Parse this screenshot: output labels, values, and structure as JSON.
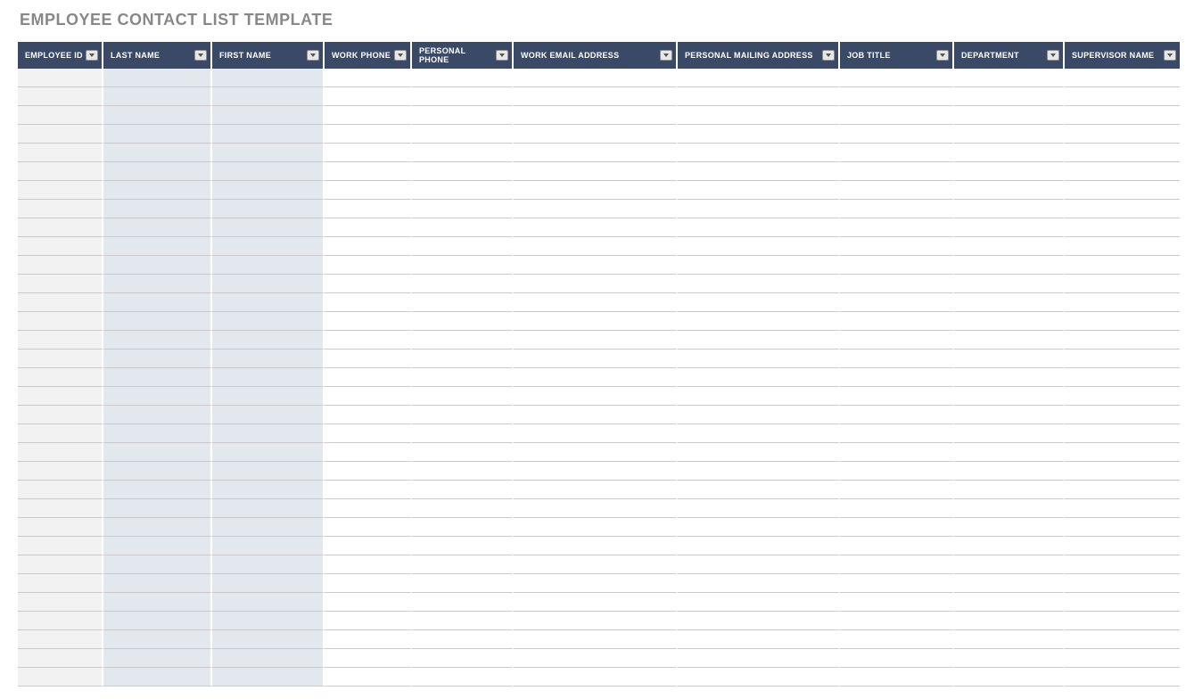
{
  "title": "EMPLOYEE CONTACT LIST TEMPLATE",
  "columns": [
    {
      "label": "EMPLOYEE ID",
      "shade": "a"
    },
    {
      "label": "LAST NAME",
      "shade": "b"
    },
    {
      "label": "FIRST NAME",
      "shade": "b"
    },
    {
      "label": "WORK PHONE",
      "shade": ""
    },
    {
      "label": "PERSONAL PHONE",
      "shade": ""
    },
    {
      "label": "WORK EMAIL ADDRESS",
      "shade": ""
    },
    {
      "label": "PERSONAL MAILING ADDRESS",
      "shade": ""
    },
    {
      "label": "JOB TITLE",
      "shade": ""
    },
    {
      "label": "DEPARTMENT",
      "shade": ""
    },
    {
      "label": "SUPERVISOR NAME",
      "shade": ""
    }
  ],
  "row_count": 33,
  "rows": []
}
